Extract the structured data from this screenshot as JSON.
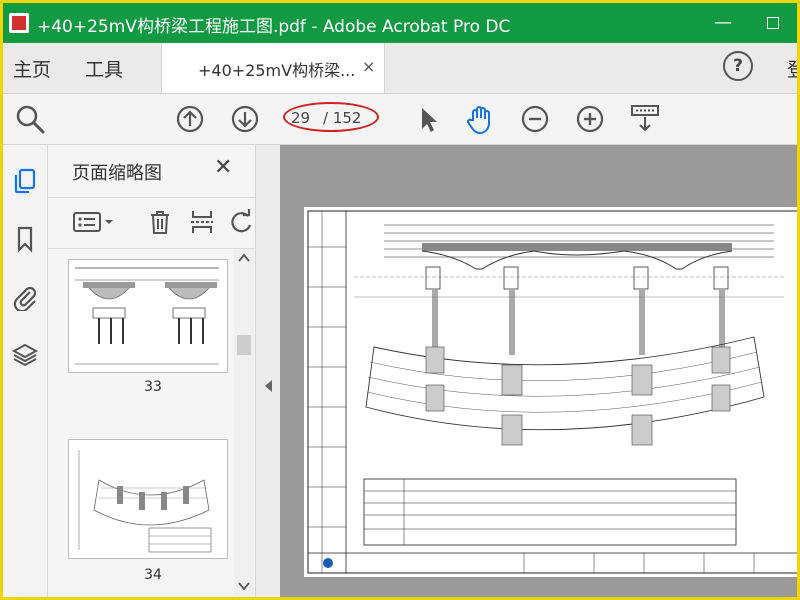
{
  "window": {
    "title": "+40+25mV构桥梁工程施工图.pdf - Adobe Acrobat Pro DC",
    "minimize_symbol": "—",
    "maximize_icon": "maximize-icon"
  },
  "menu": {
    "home": "主页",
    "tools": "工具",
    "signin": "登"
  },
  "tab": {
    "label": "+40+25mV构桥梁...",
    "close_symbol": "×"
  },
  "help_symbol": "?",
  "toolbar": {
    "page_current": "29",
    "page_total": "/ 152",
    "icons": [
      "search-icon",
      "page-up-icon",
      "page-down-icon",
      "select-arrow-icon",
      "hand-tool-icon",
      "zoom-out-icon",
      "zoom-in-icon",
      "keyboard-scroll-icon"
    ]
  },
  "rail_icons": [
    "pages-icon",
    "bookmark-icon",
    "attachment-icon",
    "layers-icon"
  ],
  "thumbnail_panel": {
    "title": "页面缩略图",
    "close_symbol": "✕",
    "tools": [
      "thumbnail-options-icon",
      "delete-icon",
      "crop-icon",
      "rotate-icon"
    ],
    "pages": [
      {
        "label": "33"
      },
      {
        "label": "34"
      }
    ]
  },
  "colors": {
    "titlebar": "#129a42",
    "highlight_ring": "#d42020",
    "active_icon": "#1473e6"
  }
}
